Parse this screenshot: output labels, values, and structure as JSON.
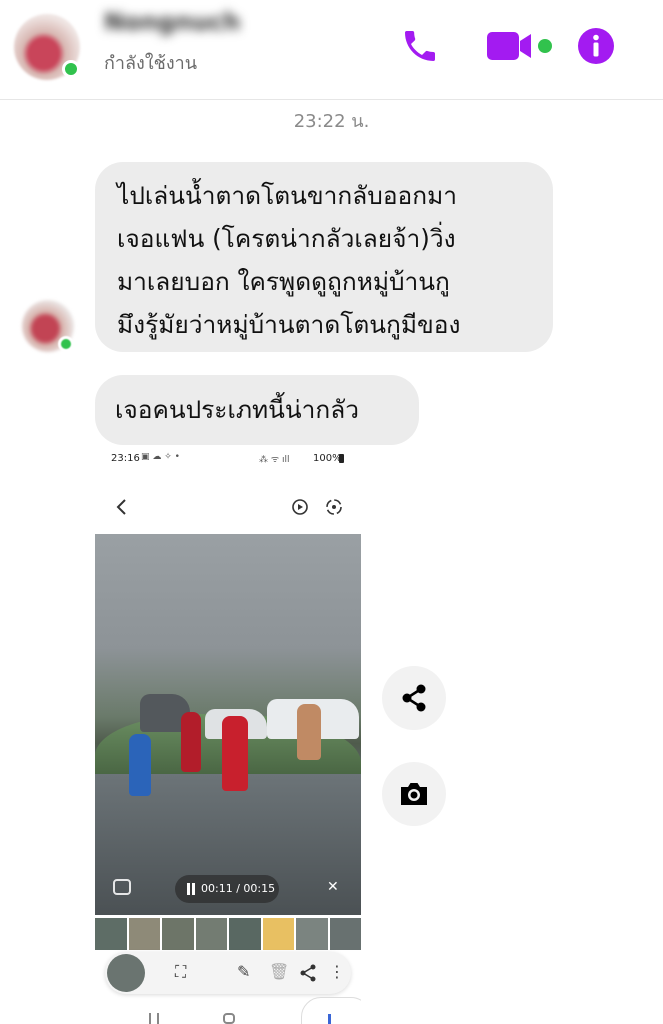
{
  "header": {
    "contact_name": "Nongnuch",
    "status_text": "กำลังใช้งาน",
    "icons": [
      "phone-icon",
      "video-call-icon",
      "info-icon"
    ],
    "accent_color": "#a31bf1"
  },
  "timestamp": "23:22 น.",
  "messages": [
    {
      "lines": [
        "ไปเล่นน้ำตาดโตนขากลับออกมา",
        "เจอแฟน (โครตน่ากลัวเลยจ้า)วิ่ง",
        "มาเลยบอก ใครพูดดูถูกหมู่บ้านกู",
        "มึงรู้มัยว่าหมู่บ้านตาดโตนกูมีของ"
      ]
    },
    {
      "lines": [
        "เจอคนประเภทนี้น่ากลัว"
      ]
    }
  ],
  "screenshot": {
    "status_time": "23:16",
    "battery": "100%",
    "video_time": "00:11 / 00:15"
  },
  "actions": {
    "share_icon": "share-icon",
    "camera_icon": "camera-icon"
  }
}
